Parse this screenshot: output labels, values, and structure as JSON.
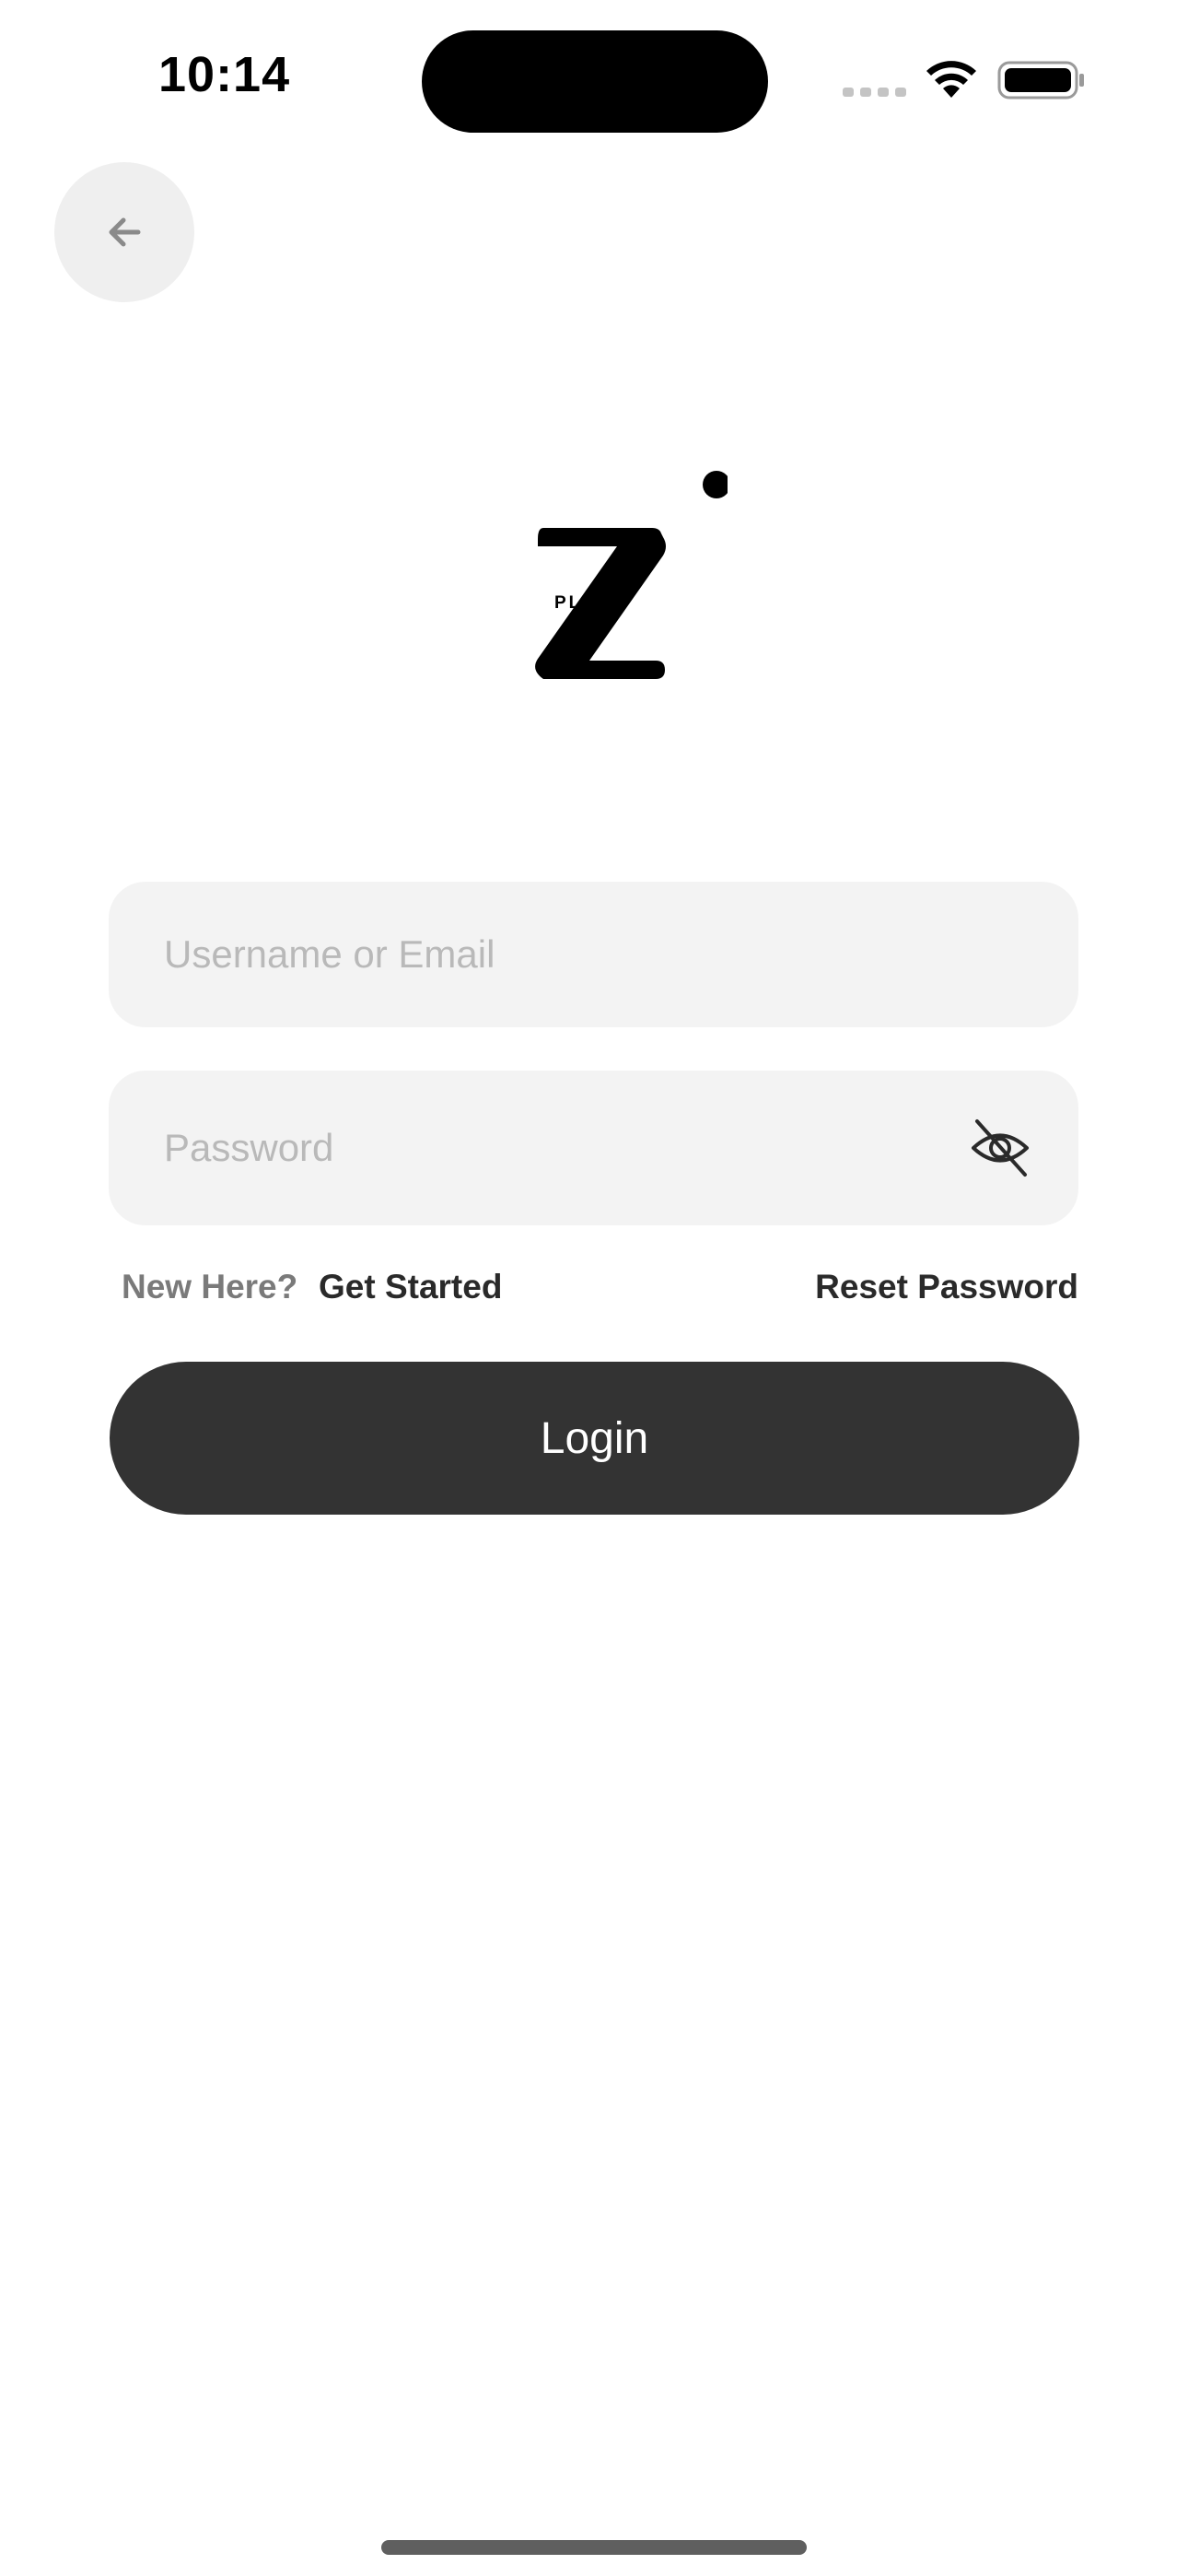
{
  "status_bar": {
    "time": "10:14"
  },
  "navigation": {
    "back_icon": "arrow-left-icon"
  },
  "logo": {
    "letter": "Z",
    "sub_text": "PLAN"
  },
  "form": {
    "username": {
      "placeholder": "Username or Email",
      "value": ""
    },
    "password": {
      "placeholder": "Password",
      "value": "",
      "toggle_icon": "eye-off-icon"
    },
    "new_here_label": "New Here?",
    "get_started_label": "Get Started",
    "reset_password_label": "Reset Password",
    "login_label": "Login"
  },
  "colors": {
    "primary_button": "#333333",
    "field_background": "#f3f3f3",
    "placeholder": "#b9b9b9",
    "muted_text": "#7a7a7a"
  }
}
